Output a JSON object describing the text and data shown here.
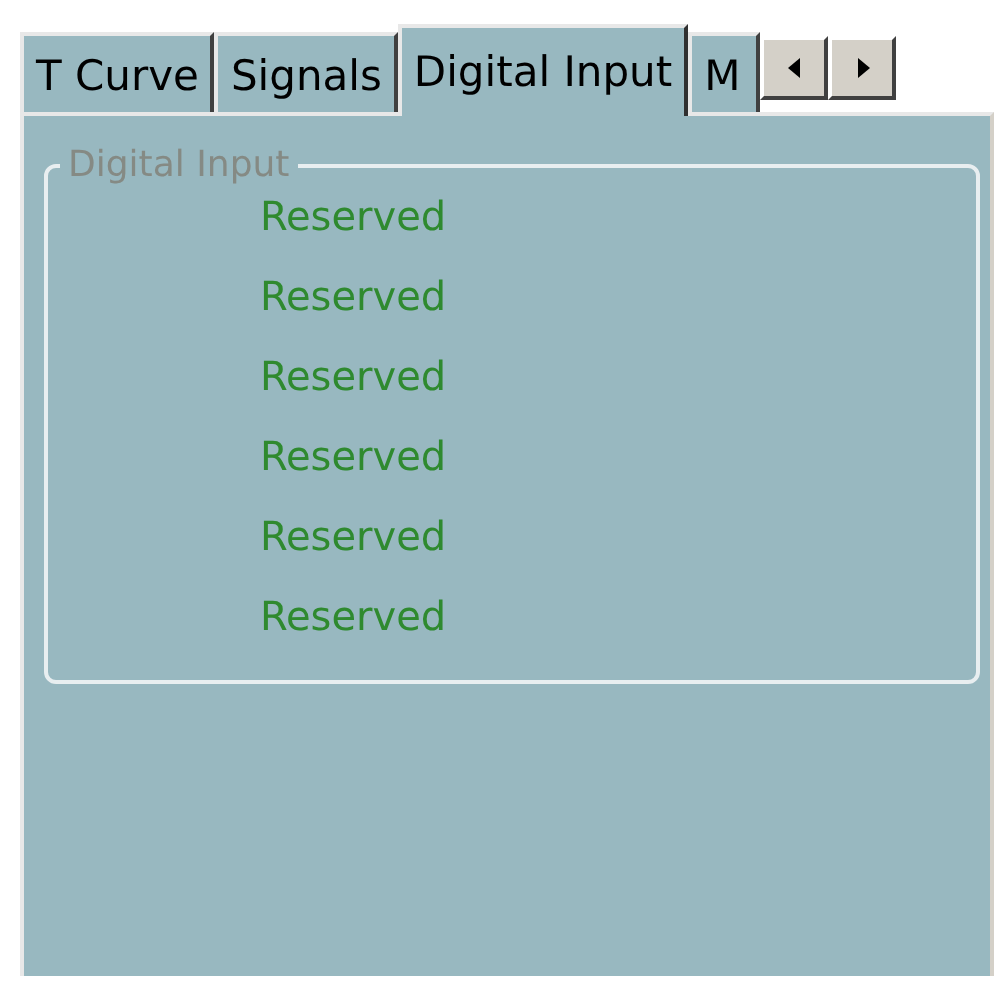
{
  "tabs": [
    {
      "label": "T Curve",
      "selected": false
    },
    {
      "label": "Signals",
      "selected": false
    },
    {
      "label": "Digital Input",
      "selected": true
    },
    {
      "label": "M",
      "selected": false
    }
  ],
  "group": {
    "title": "Digital Input",
    "items": [
      "Reserved",
      "Reserved",
      "Reserved",
      "Reserved",
      "Reserved",
      "Reserved"
    ]
  }
}
